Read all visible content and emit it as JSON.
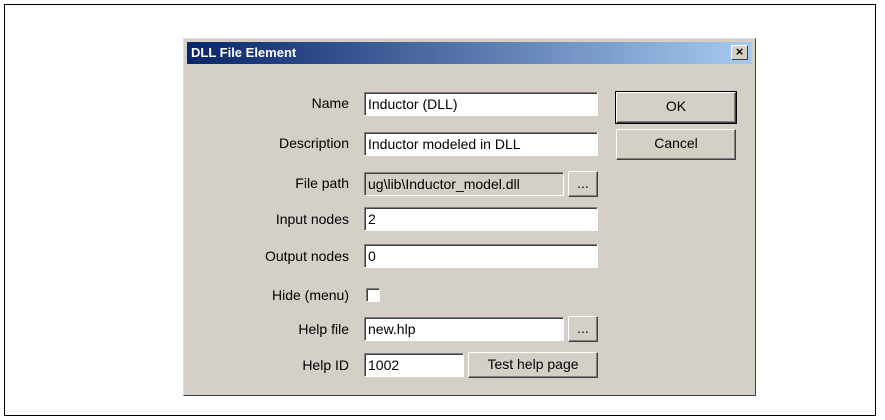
{
  "dialog": {
    "title": "DLL File Element",
    "close_glyph": "×"
  },
  "fields": {
    "name": {
      "label": "Name",
      "value": "Inductor (DLL)"
    },
    "description": {
      "label": "Description",
      "value": "Inductor modeled in DLL"
    },
    "file_path": {
      "label": "File path",
      "value": "ug\\lib\\Inductor_model.dll"
    },
    "input_nodes": {
      "label": "Input nodes",
      "value": "2"
    },
    "output_nodes": {
      "label": "Output nodes",
      "value": "0"
    },
    "hide_menu": {
      "label": "Hide (menu)",
      "checked": false
    },
    "help_file": {
      "label": "Help file",
      "value": "new.hlp"
    },
    "help_id": {
      "label": "Help ID",
      "value": "1002"
    }
  },
  "buttons": {
    "ok": "OK",
    "cancel": "Cancel",
    "browse": "...",
    "test_help": "Test help page"
  },
  "colors": {
    "titlebar_start": "#0a246a",
    "titlebar_end": "#a6caf0",
    "dialog_face": "#d4d0c8"
  }
}
